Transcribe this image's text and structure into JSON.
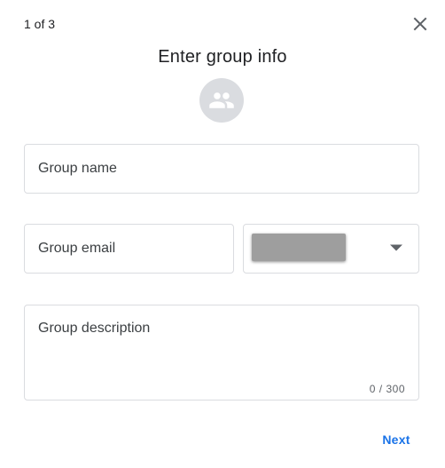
{
  "dialog": {
    "step_label": "1 of 3",
    "title": "Enter group info",
    "avatar_icon": "group-icon",
    "close_icon": "close-icon"
  },
  "form": {
    "group_name_placeholder": "Group name",
    "group_email_placeholder": "Group email",
    "domain_icon": "chevron-down-icon",
    "group_description_placeholder": "Group description",
    "description_counter": "0 / 300"
  },
  "actions": {
    "next_label": "Next"
  },
  "colors": {
    "accent": "#1a73e8",
    "border": "#dadce0",
    "avatar_bg": "#dadce0"
  }
}
